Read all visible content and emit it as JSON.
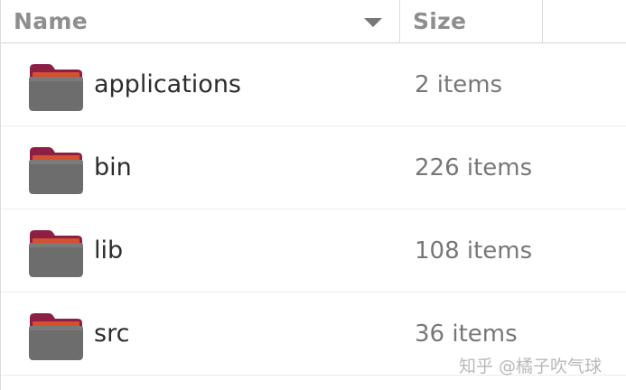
{
  "columns": {
    "name_label": "Name",
    "size_label": "Size",
    "sort_icon": "sort-descending-arrow"
  },
  "folder_icon": "folder-icon",
  "colors": {
    "folder_body": "#6d6d6d",
    "folder_tab": "#8d1f44",
    "folder_accent": "#d5502f",
    "header_text": "#8e8e8e",
    "name_text": "#2c2c2c",
    "size_text": "#777777"
  },
  "rows": [
    {
      "name": "applications",
      "size": "2 items"
    },
    {
      "name": "bin",
      "size": "226 items"
    },
    {
      "name": "lib",
      "size": "108 items"
    },
    {
      "name": "src",
      "size": "36 items"
    }
  ],
  "watermark": "知乎 @橘子吹气球"
}
